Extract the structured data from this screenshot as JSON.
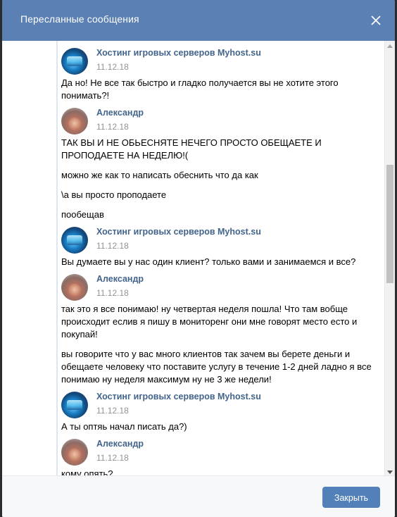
{
  "modal": {
    "title": "Пересланные сообщения",
    "close_icon": "close-icon",
    "footer_button": "Закрыть"
  },
  "messages": [
    {
      "author": "Хостинг игровых серверов Myhost.su",
      "avatar": "host",
      "date": "11.12.18",
      "texts": [
        "Да но! Не все так быстро и гладко получается вы не хотите этого понимать?!"
      ]
    },
    {
      "author": "Александр",
      "avatar": "user",
      "date": "11.12.18",
      "texts": [
        "ТАК ВЫ И НЕ ОБЬЕСНЯТЕ НЕЧЕГО ПРОСТО ОБЕЩАЕТЕ И ПРОПОДАЕТЕ НА НЕДЕЛЮ!(",
        "можно же как то написать обеснить что да как",
        "\\а вы просто проподаете",
        "пообещав"
      ]
    },
    {
      "author": "Хостинг игровых серверов Myhost.su",
      "avatar": "host",
      "date": "11.12.18",
      "texts": [
        "Вы думаете вы у нас один клиент? только вами и занимаемся и все?"
      ]
    },
    {
      "author": "Александр",
      "avatar": "user",
      "date": "11.12.18",
      "texts": [
        "так это я все понимаю! ну четвертая неделя пошла! Что там вобще происходит еслив я пишу в мониторенг они мне говорят место есто и покупай!",
        "вы говорите что у вас много клиентов так зачем вы берете деньги и обещаете человеку что поставите услугу в течение 1-2 дней ладно я все понимаю ну неделя максимум ну не 3 же недели!"
      ]
    },
    {
      "author": "Хостинг игровых серверов Myhost.su",
      "avatar": "host",
      "date": "11.12.18",
      "texts": [
        "А ты оптяь начал писать да?)"
      ]
    },
    {
      "author": "Александр",
      "avatar": "user",
      "date": "11.12.18",
      "texts": [
        "кому опять?"
      ]
    }
  ],
  "colors": {
    "header": "#5b80b3",
    "author_link": "#42648b",
    "date": "#939393",
    "button": "#5181b8"
  }
}
